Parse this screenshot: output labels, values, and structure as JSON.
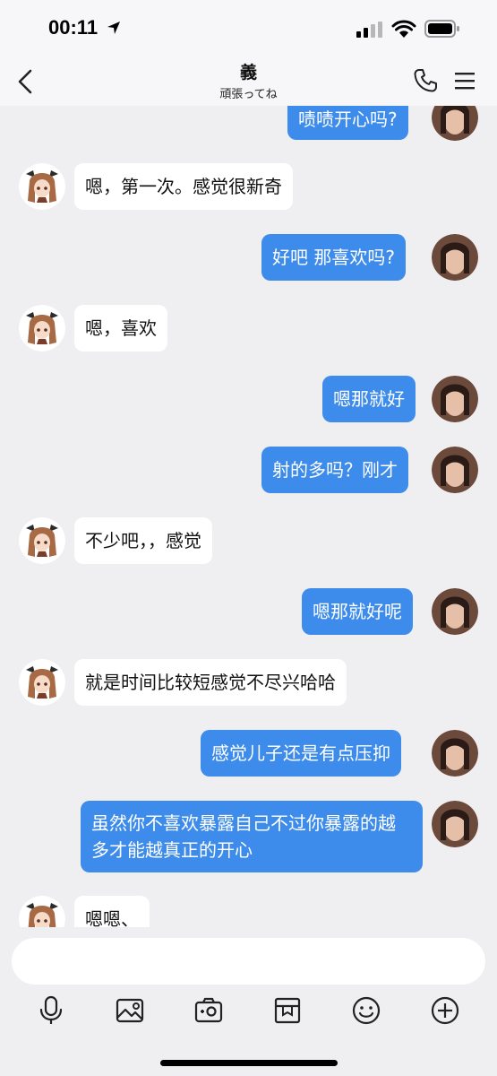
{
  "status_bar": {
    "time": "00:11"
  },
  "header": {
    "title": "義",
    "subtitle": "頑張ってね"
  },
  "messages": [
    {
      "side": "right",
      "text": "啧啧开心吗?"
    },
    {
      "side": "left",
      "text": "嗯，第一次。感觉很新奇"
    },
    {
      "side": "right",
      "text": "好吧 那喜欢吗?"
    },
    {
      "side": "left",
      "text": "嗯，喜欢"
    },
    {
      "side": "right",
      "text": "嗯那就好"
    },
    {
      "side": "right",
      "text": "射的多吗？刚才"
    },
    {
      "side": "left",
      "text": "不少吧，，感觉"
    },
    {
      "side": "right",
      "text": "嗯那就好呢"
    },
    {
      "side": "left",
      "text": "就是时间比较短感觉不尽兴哈哈"
    },
    {
      "side": "right",
      "text": "感觉儿子还是有点压抑"
    },
    {
      "side": "right",
      "text": "虽然你不喜欢暴露自己不过你暴露的越多才能越真正的开心"
    },
    {
      "side": "left",
      "text": "嗯嗯、"
    }
  ],
  "input": {
    "placeholder": ""
  },
  "toolbar": {
    "icons": [
      "microphone-icon",
      "image-icon",
      "camera-icon",
      "gift-box-icon",
      "emoji-icon",
      "plus-icon"
    ]
  },
  "colors": {
    "accent": "#3d8bea",
    "background": "#efeff2",
    "bubble_left": "#ffffff"
  }
}
